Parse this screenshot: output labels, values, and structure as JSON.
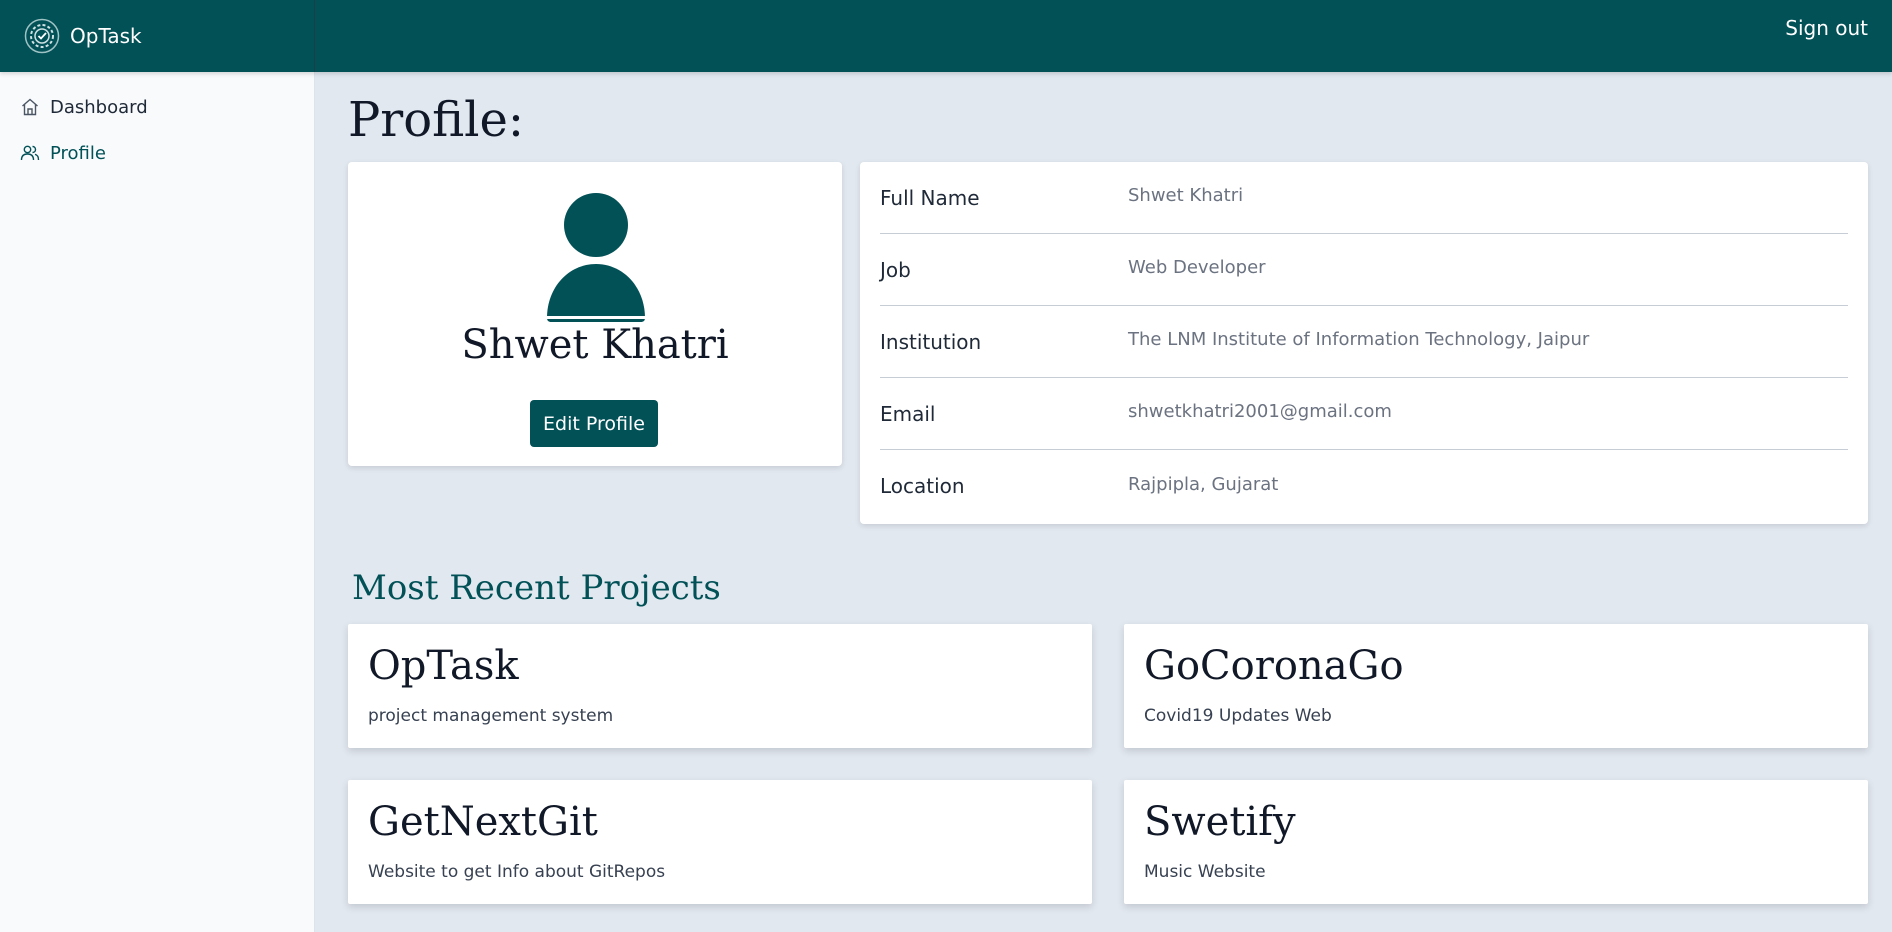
{
  "app": {
    "name": "OpTask",
    "signout_label": "Sign out"
  },
  "sidebar": {
    "items": [
      {
        "label": "Dashboard",
        "icon": "home-icon",
        "active": false
      },
      {
        "label": "Profile",
        "icon": "users-icon",
        "active": true
      }
    ]
  },
  "main": {
    "page_title": "Profile:",
    "profile": {
      "name": "Shwet Khatri",
      "edit_label": "Edit Profile"
    },
    "info": [
      {
        "label": "Full Name",
        "value": "Shwet Khatri"
      },
      {
        "label": "Job",
        "value": "Web Developer"
      },
      {
        "label": "Institution",
        "value": "The LNM Institute of Information Technology, Jaipur"
      },
      {
        "label": "Email",
        "value": "shwetkhatri2001@gmail.com"
      },
      {
        "label": "Location",
        "value": "Rajpipla, Gujarat"
      }
    ],
    "projects_title": "Most Recent Projects",
    "projects": [
      {
        "title": "OpTask",
        "desc": "project management system"
      },
      {
        "title": "GoCoronaGo",
        "desc": "Covid19 Updates Web"
      },
      {
        "title": "GetNextGit",
        "desc": "Website to get Info about GitRepos"
      },
      {
        "title": "Swetify",
        "desc": "Music Website"
      }
    ]
  },
  "colors": {
    "primary": "#025157",
    "background": "#e2e8f0",
    "sidebar": "#f8fafc"
  }
}
